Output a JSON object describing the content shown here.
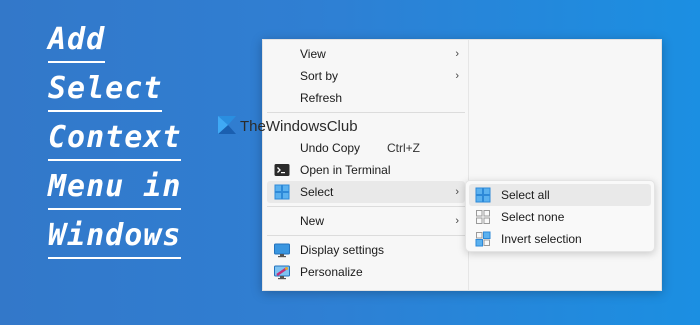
{
  "title": {
    "lines": [
      "Add",
      "Select",
      "Context",
      "Menu in",
      "Windows"
    ]
  },
  "watermark": {
    "text": "TheWindowsClub"
  },
  "context_menu": {
    "items": [
      {
        "label": "View",
        "has_submenu": true
      },
      {
        "label": "Sort by",
        "has_submenu": true
      },
      {
        "label": "Refresh"
      },
      {
        "label": "Undo Copy",
        "shortcut": "Ctrl+Z"
      },
      {
        "label": "Open in Terminal",
        "icon": "terminal-icon"
      },
      {
        "label": "Select",
        "icon": "select-icon",
        "has_submenu": true,
        "highlighted": true
      },
      {
        "label": "New",
        "has_submenu": true
      },
      {
        "label": "Display settings",
        "icon": "display-icon"
      },
      {
        "label": "Personalize",
        "icon": "personalize-icon"
      }
    ],
    "arrow_glyph": "›"
  },
  "submenu": {
    "items": [
      {
        "label": "Select all",
        "icon": "select-all-icon",
        "highlighted": true
      },
      {
        "label": "Select none",
        "icon": "select-none-icon"
      },
      {
        "label": "Invert selection",
        "icon": "invert-selection-icon"
      }
    ]
  },
  "colors": {
    "background_left": "#3378c9",
    "background_right": "#1b8fe2",
    "menu_bg": "#f7f7f7",
    "highlight": "#e9e9e9",
    "icon_blue": "#2d89d8"
  }
}
